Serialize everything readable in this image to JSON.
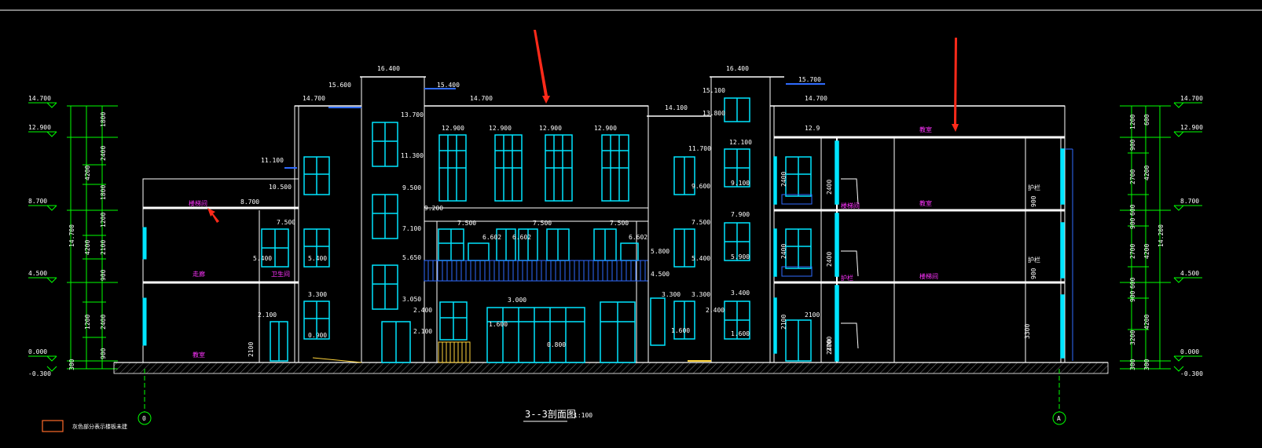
{
  "colors": {
    "background": "#000000",
    "wall": "#ffffff",
    "window": "#00e5ff",
    "dimension": "#00ff00",
    "label_magenta": "#ff33ff",
    "railing_blue": "#2f6bff",
    "yellow": "#ffd43b",
    "arrow": "#ff2a1a",
    "legend_box": "#ff6a2a"
  },
  "title": {
    "name": "3--3剖面图",
    "scale": "1:100"
  },
  "axis_labels": {
    "left": "0",
    "right": "A"
  },
  "legend": {
    "label": "灰色部分表示楼板未建"
  },
  "left_scale": {
    "elevations": [
      "14.700",
      "12.900",
      "8.700",
      "4.500",
      "0.000",
      "-0.300"
    ],
    "segments": [
      "1800",
      "4200",
      "4200",
      "300",
      "1800",
      "2400",
      "1800",
      "1200",
      "2100",
      "900",
      "1200",
      "2400",
      "1200",
      "900",
      "300"
    ],
    "total": "14.700"
  },
  "right_scale": {
    "elevations": [
      "14.700",
      "12.900",
      "8.700",
      "4.500",
      "0.000",
      "-0.300"
    ],
    "segments": [
      "1200",
      "600",
      "900",
      "2700",
      "600",
      "900",
      "2700",
      "600",
      "900",
      "300",
      "300",
      "3200",
      "4200",
      "4200",
      "4200",
      "300"
    ],
    "total": "14.200"
  },
  "elevations": {
    "top_left": [
      "16.400",
      "15.600",
      "15.400",
      "14.700",
      "14.700",
      "13.700",
      "11.300",
      "11.100",
      "10.500",
      "9.500",
      "9.200",
      "7.100",
      "5.650",
      "3.050",
      "2.400",
      "2.100"
    ],
    "mid": [
      "12.900",
      "12.900",
      "12.900",
      "12.900",
      "7.500",
      "7.500",
      "7.500",
      "6.602",
      "6.602",
      "6.602",
      "3.000",
      "1.600",
      "0.800"
    ],
    "left_wing": [
      "8.700",
      "7.500",
      "5.400",
      "5.400",
      "3.300",
      "2.100",
      "0.900"
    ],
    "right_mid": [
      "16.400",
      "15.700",
      "15.100",
      "14.100",
      "13.800",
      "12.100",
      "11.700",
      "9.600",
      "9.100",
      "7.900",
      "7.500",
      "5.900",
      "5.800",
      "5.400",
      "4.500",
      "3.400",
      "3.300",
      "3.300",
      "2.400",
      "1.600",
      "1.600"
    ],
    "right_wing": [
      "14.700",
      "12.9",
      "2400",
      "2400",
      "2400",
      "2400",
      "2100",
      "2100",
      "2700",
      "2400",
      "3300",
      "900",
      "900"
    ],
    "left_wing_labels": [
      "2100",
      "2100"
    ]
  },
  "room_labels": [
    "楼梯间",
    "走廊",
    "卫生间",
    "教室",
    "教室",
    "教室",
    "楼梯间",
    "楼梯间",
    "护栏",
    "护栏",
    "护栏"
  ]
}
